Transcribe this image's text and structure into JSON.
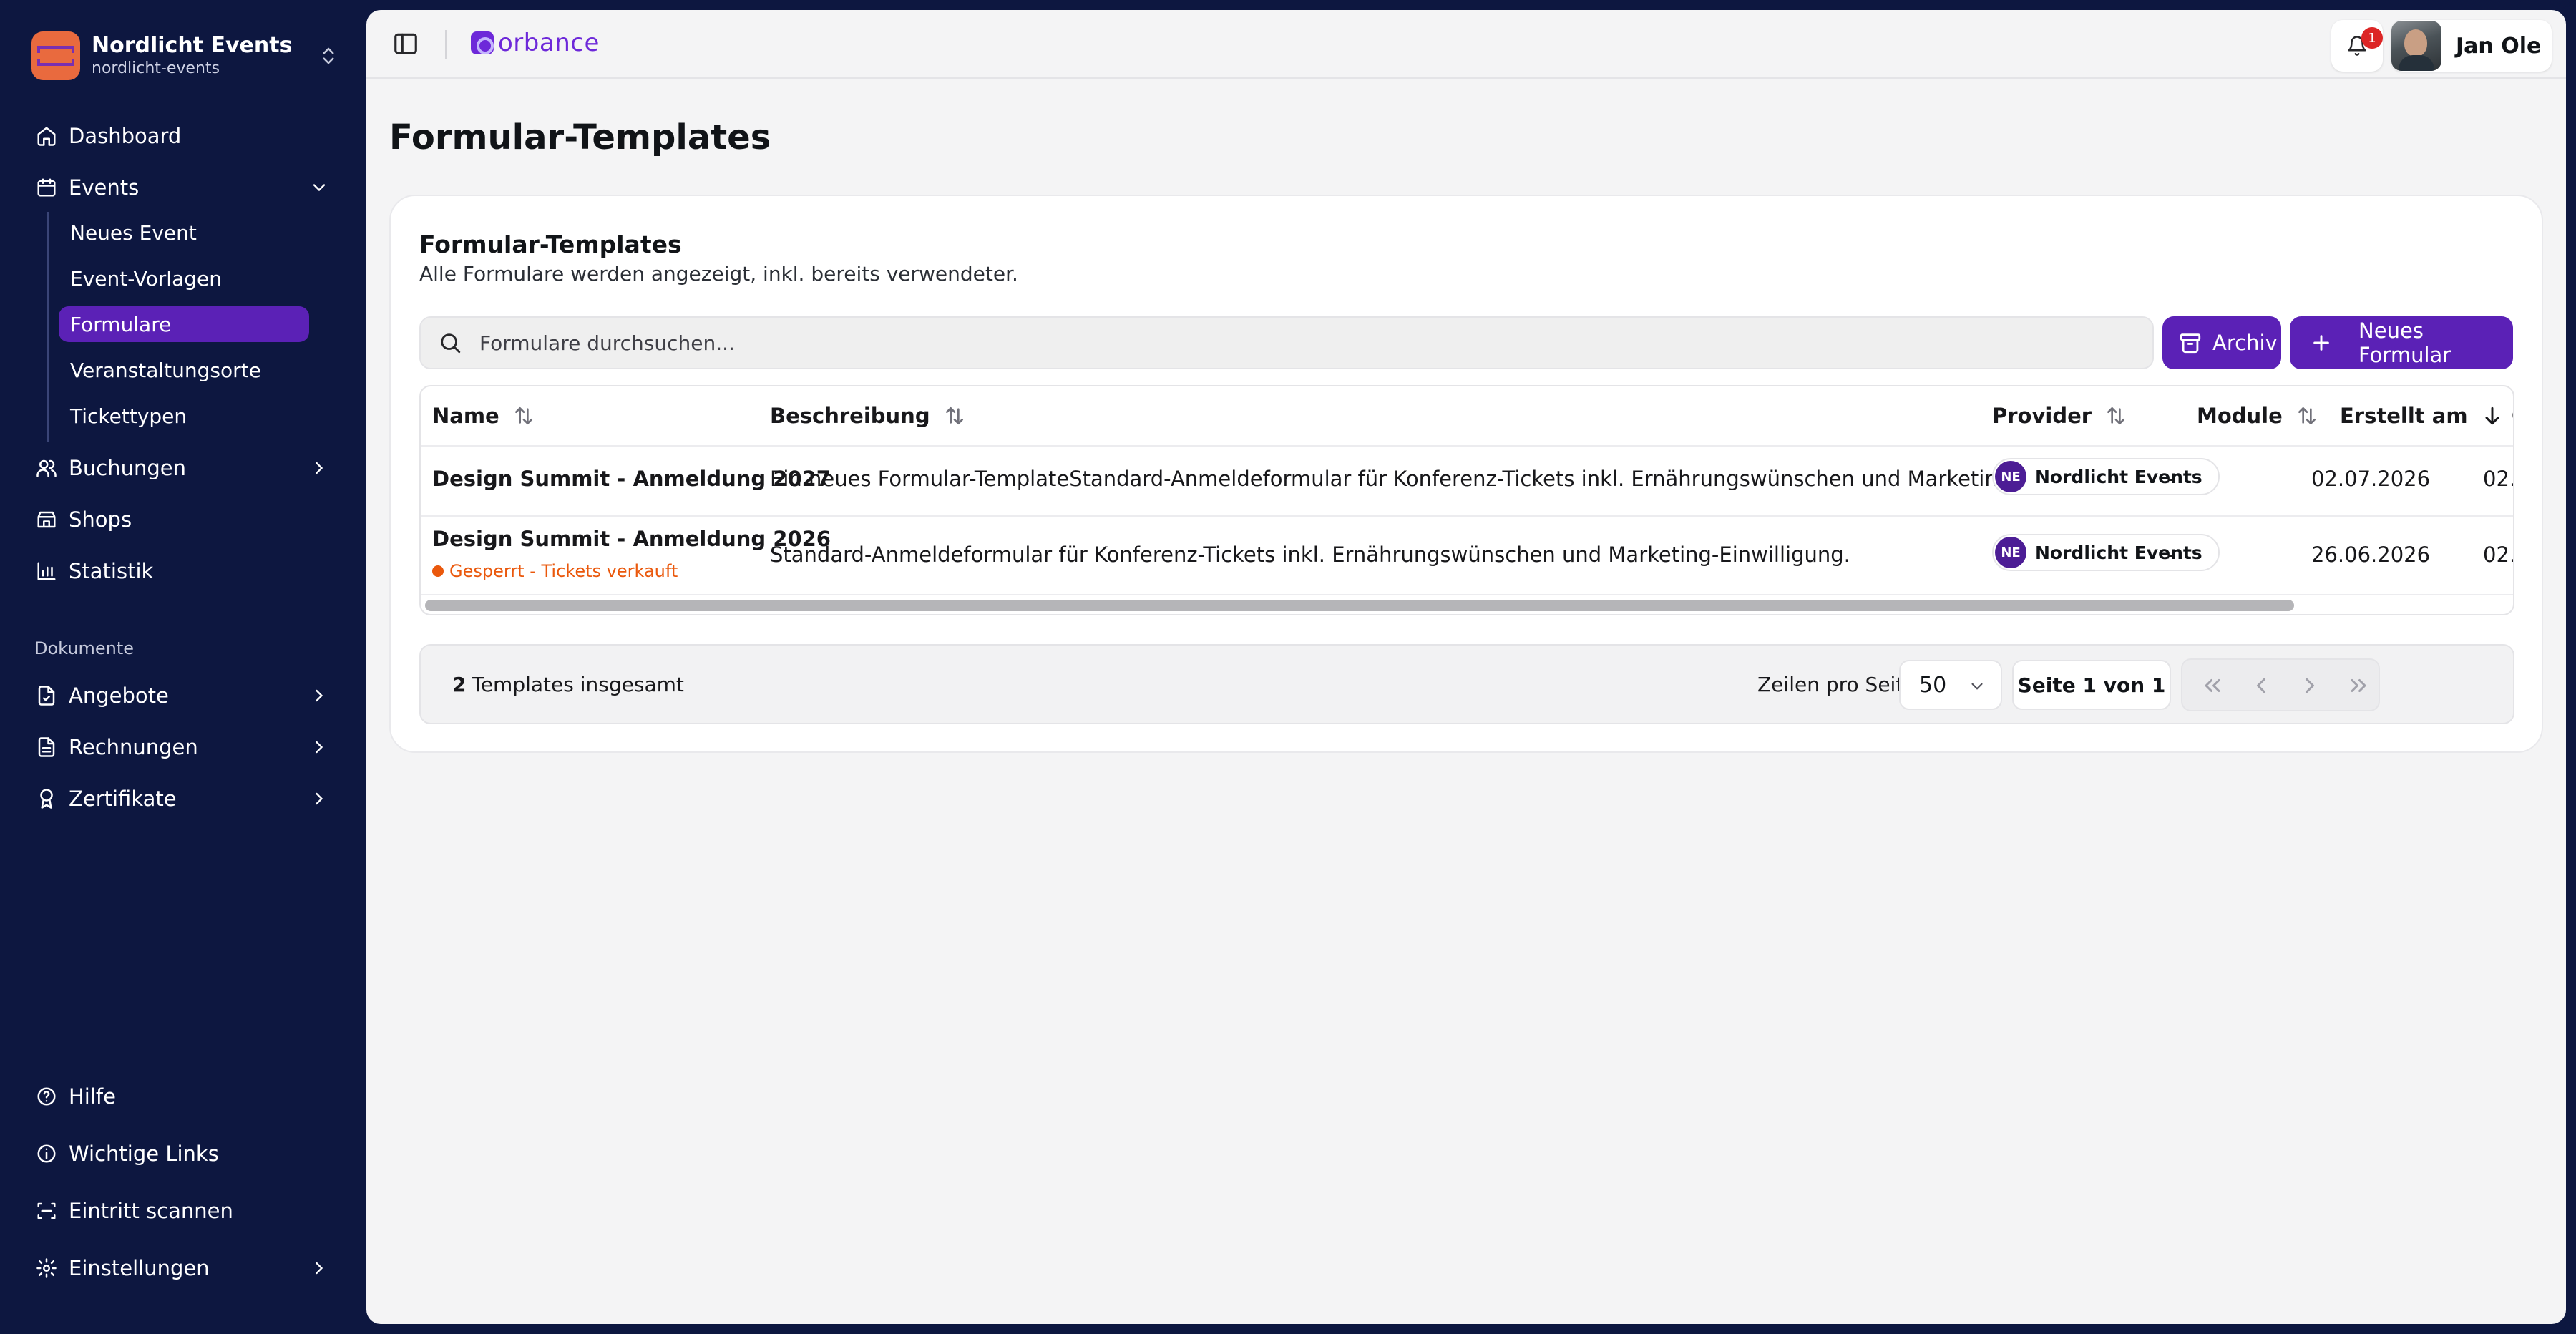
{
  "sidebar": {
    "org_name": "Nordlicht Events",
    "org_slug": "nordlicht-events",
    "items": [
      {
        "label": "Dashboard",
        "icon": "home-icon"
      },
      {
        "label": "Events",
        "icon": "calendar-icon"
      },
      {
        "label": "Buchungen",
        "icon": "users-icon"
      },
      {
        "label": "Shops",
        "icon": "store-icon"
      },
      {
        "label": "Statistik",
        "icon": "bar-chart-icon"
      }
    ],
    "events_sub": [
      {
        "label": "Neues Event"
      },
      {
        "label": "Event-Vorlagen"
      },
      {
        "label": "Formulare"
      },
      {
        "label": "Veranstaltungsorte"
      },
      {
        "label": "Tickettypen"
      }
    ],
    "documents_label": "Dokumente",
    "documents": [
      {
        "label": "Angebote",
        "icon": "file-check-icon"
      },
      {
        "label": "Rechnungen",
        "icon": "file-text-icon"
      },
      {
        "label": "Zertifikate",
        "icon": "award-icon"
      }
    ],
    "bottom": [
      {
        "label": "Hilfe",
        "icon": "help-circle-icon"
      },
      {
        "label": "Wichtige Links",
        "icon": "info-icon"
      },
      {
        "label": "Eintritt scannen",
        "icon": "scan-icon"
      },
      {
        "label": "Einstellungen",
        "icon": "gear-icon"
      }
    ]
  },
  "topbar": {
    "brand": "orbance",
    "notification_count": "1",
    "user_name": "Jan Ole"
  },
  "page": {
    "title": "Formular-Templates"
  },
  "card": {
    "title": "Formular-Templates",
    "subtitle": "Alle Formulare werden angezeigt, inkl. bereits verwendeter.",
    "search_placeholder": "Formulare durchsuchen...",
    "archive_label": "Archiv",
    "new_label": "Neues Formular"
  },
  "table": {
    "columns": [
      "Name",
      "Beschreibung",
      "Provider",
      "Module",
      "Erstellt am",
      "Ge"
    ],
    "rows": [
      {
        "name": "Design Summit - Anmeldung 2027",
        "description": "Ein neues Formular-TemplateStandard-Anmeldeformular für Konferenz-Tickets inkl. Ernährungswünschen und Marketing-Einwilligung.",
        "provider_initials": "NE",
        "provider": "Nordlicht Events",
        "modules": "-",
        "created": "02.07.2026",
        "updated_partial": "02."
      },
      {
        "name": "Design Summit - Anmeldung 2026",
        "status": "Gesperrt - Tickets verkauft",
        "description": "Standard-Anmeldeformular für Konferenz-Tickets inkl. Ernährungswünschen und Marketing-Einwilligung.",
        "provider_initials": "NE",
        "provider": "Nordlicht Events",
        "modules": "-",
        "created": "26.06.2026",
        "updated_partial": "02."
      }
    ]
  },
  "footer": {
    "total_count": "2",
    "total_label": "Templates insgesamt",
    "rows_per_page_label": "Zeilen pro Seite",
    "rows_per_page_value": "50",
    "page_info": "Seite 1 von 1"
  },
  "colors": {
    "sidebar_bg": "#0d1740",
    "accent": "#5b21b6",
    "warning": "#ea580c",
    "badge": "#dc2626"
  }
}
